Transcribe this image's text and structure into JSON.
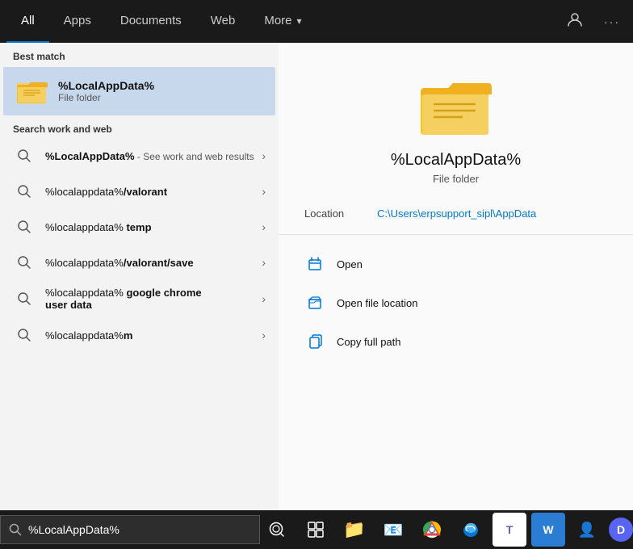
{
  "nav": {
    "tabs": [
      {
        "id": "all",
        "label": "All",
        "active": true
      },
      {
        "id": "apps",
        "label": "Apps"
      },
      {
        "id": "documents",
        "label": "Documents"
      },
      {
        "id": "web",
        "label": "Web"
      },
      {
        "id": "more",
        "label": "More"
      }
    ],
    "icons": {
      "user_icon": "👤",
      "dots_icon": "···"
    }
  },
  "left": {
    "best_match_label": "Best match",
    "best_match": {
      "title": "%LocalAppData%",
      "subtitle": "File folder"
    },
    "search_web_label": "Search work and web",
    "items": [
      {
        "id": 0,
        "text_before": "%LocalAppData%",
        "text_after": " - See work and web results",
        "bold_part": ""
      },
      {
        "id": 1,
        "text_main": "%localappdata%",
        "text_bold": "/valorant",
        "text_after": ""
      },
      {
        "id": 2,
        "text_main": "%localappdata%",
        "text_bold": " temp",
        "text_after": ""
      },
      {
        "id": 3,
        "text_main": "%localappdata%",
        "text_bold": "/valorant/save",
        "text_after": ""
      },
      {
        "id": 4,
        "text_main": "%localappdata%",
        "text_bold": " google chrome user data",
        "text_after": ""
      },
      {
        "id": 5,
        "text_main": "%localappdata%",
        "text_bold": "m",
        "text_after": ""
      }
    ]
  },
  "right": {
    "title": "%LocalAppData%",
    "subtitle": "File folder",
    "location_label": "Location",
    "location_path": "C:\\Users\\erpsupport_sipl\\AppData",
    "actions": [
      {
        "id": "open",
        "label": "Open"
      },
      {
        "id": "open_file_location",
        "label": "Open file location"
      },
      {
        "id": "copy_full_path",
        "label": "Copy full path"
      }
    ]
  },
  "taskbar": {
    "search_value": "%LocalAppData%",
    "search_placeholder": "",
    "icons": [
      {
        "id": "search",
        "symbol": "⊙",
        "color": "#fff"
      },
      {
        "id": "task-view",
        "symbol": "⧉",
        "color": "#fff"
      },
      {
        "id": "file-explorer",
        "symbol": "📁",
        "color": "#e8b84b"
      },
      {
        "id": "outlook",
        "symbol": "📧",
        "color": "#0078d4"
      },
      {
        "id": "chrome",
        "symbol": "⊕",
        "color": "#4caf50"
      },
      {
        "id": "edge",
        "symbol": "🌊",
        "color": "#0078d4"
      },
      {
        "id": "teams",
        "symbol": "T",
        "color": "#6264a7"
      },
      {
        "id": "word",
        "symbol": "W",
        "color": "#2b7cd3"
      },
      {
        "id": "user2",
        "symbol": "👤",
        "color": "#888"
      },
      {
        "id": "discord",
        "symbol": "D",
        "color": "#5865f2"
      }
    ]
  }
}
